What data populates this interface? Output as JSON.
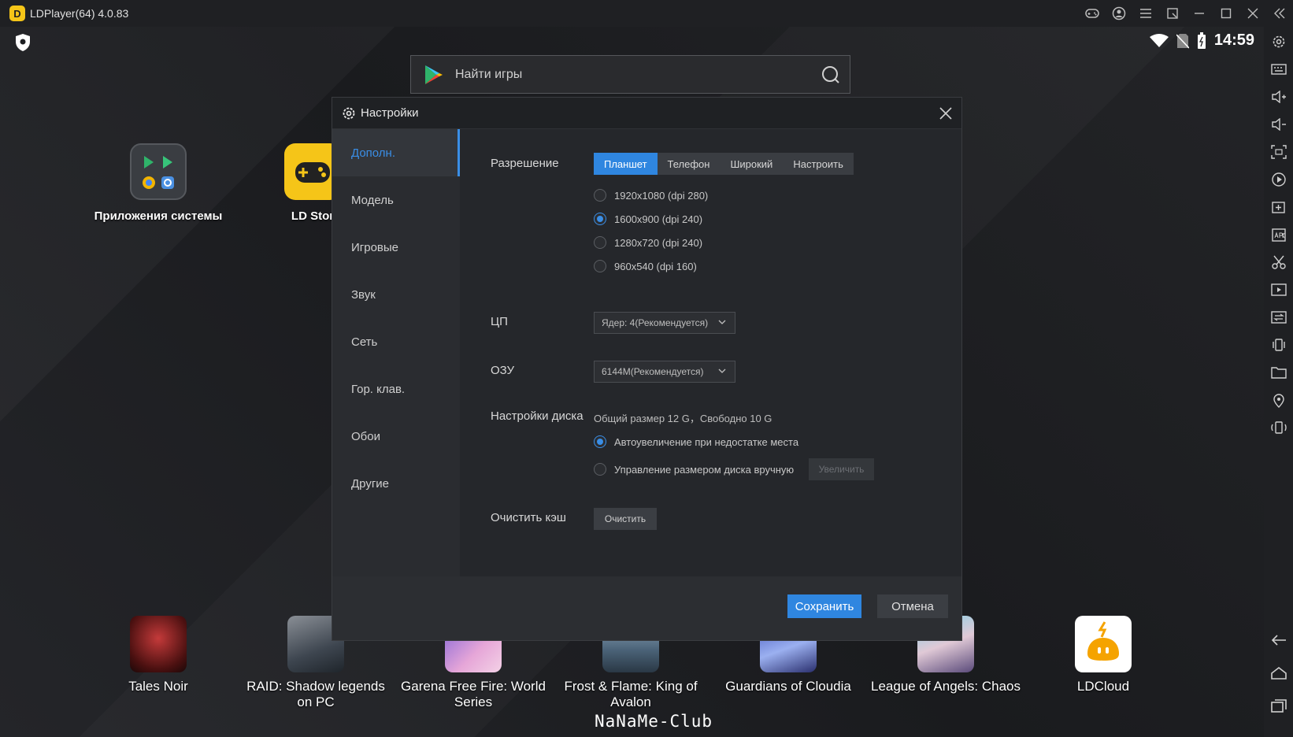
{
  "window": {
    "title": "LDPlayer(64) 4.0.83",
    "logo_letter": "D"
  },
  "status_bar": {
    "time": "14:59"
  },
  "search": {
    "placeholder": "Найти игры"
  },
  "desktop_apps": [
    {
      "label": "Приложения системы"
    },
    {
      "label": "LD Stor"
    }
  ],
  "dock_apps": [
    {
      "label": "Tales Noir"
    },
    {
      "label": "RAID: Shadow legends on PC"
    },
    {
      "label": "Garena Free Fire: World Series"
    },
    {
      "label": "Frost & Flame: King of Avalon"
    },
    {
      "label": "Guardians of Cloudia"
    },
    {
      "label": "League of Angels: Chaos"
    },
    {
      "label": "LDCloud"
    }
  ],
  "watermark": "NaNaMe-Club",
  "dialog": {
    "title": "Настройки",
    "sidebar": [
      {
        "label": "Дополн.",
        "active": true
      },
      {
        "label": "Модель"
      },
      {
        "label": "Игровые"
      },
      {
        "label": "Звук"
      },
      {
        "label": "Сеть"
      },
      {
        "label": "Гор. клав."
      },
      {
        "label": "Обои"
      },
      {
        "label": "Другие"
      }
    ],
    "resolution": {
      "label": "Разрешение",
      "modes": [
        "Планшет",
        "Телефон",
        "Широкий",
        "Настроить"
      ],
      "active_mode": "Планшет",
      "options": [
        "1920x1080  (dpi 280)",
        "1600x900  (dpi 240)",
        "1280x720  (dpi 240)",
        "960x540  (dpi 160)"
      ],
      "selected_option": "1600x900  (dpi 240)"
    },
    "cpu": {
      "label": "ЦП",
      "value": "Ядер: 4(Рекомендуется)"
    },
    "ram": {
      "label": "ОЗУ",
      "value": "6144M(Рекомендуется)"
    },
    "disk": {
      "label": "Настройки диска",
      "info": "Общий размер 12 G，Свободно 10 G",
      "auto_option": "Автоувеличение при недостатке места",
      "manual_option": "Управление размером диска вручную",
      "increase_button": "Увеличить"
    },
    "cache": {
      "label": "Очистить кэш",
      "button": "Очистить"
    },
    "footer": {
      "save": "Сохранить",
      "cancel": "Отмена"
    }
  },
  "colors": {
    "accent": "#2f86e0",
    "background": "#1d1e21",
    "dialog": "#25272b"
  }
}
